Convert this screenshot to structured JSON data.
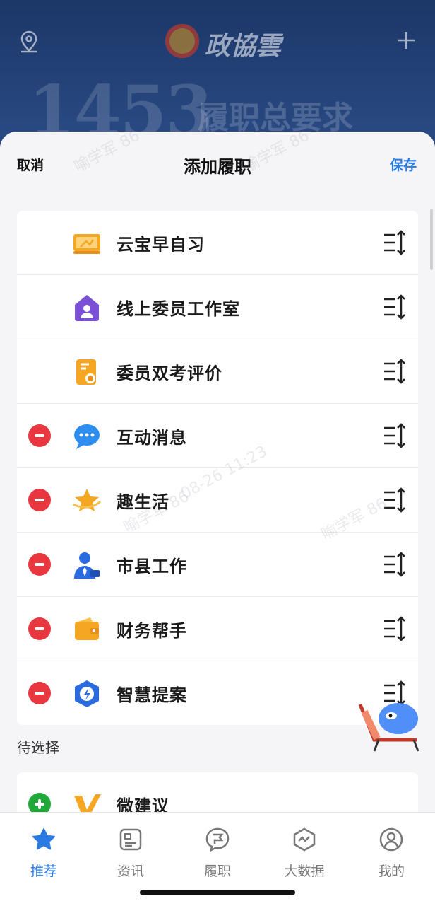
{
  "background": {
    "logo_text": "政協雲",
    "banner_number": "1453",
    "banner_text": "履职总要求"
  },
  "header": {
    "cancel_label": "取消",
    "title": "添加履职",
    "save_label": "保存"
  },
  "selected_items": [
    {
      "label": "云宝早自习",
      "icon": "blackboard-icon",
      "removable": false
    },
    {
      "label": "线上委员工作室",
      "icon": "house-person-icon",
      "removable": false
    },
    {
      "label": "委员双考评价",
      "icon": "certificate-icon",
      "removable": false
    },
    {
      "label": "互动消息",
      "icon": "chat-bubble-icon",
      "removable": true
    },
    {
      "label": "趣生活",
      "icon": "star-orbit-icon",
      "removable": true
    },
    {
      "label": "市县工作",
      "icon": "person-tie-icon",
      "removable": true
    },
    {
      "label": "财务帮手",
      "icon": "wallet-icon",
      "removable": true
    },
    {
      "label": "智慧提案",
      "icon": "lightning-shield-icon",
      "removable": true
    }
  ],
  "pending_section": {
    "label": "待选择",
    "items": [
      {
        "label": "微建议",
        "icon": "v-logo-icon"
      }
    ]
  },
  "watermark": {
    "line1": "喻学军 86",
    "line2": "08-26 11:23"
  },
  "tabbar": {
    "tabs": [
      {
        "label": "推荐",
        "icon": "star-icon",
        "active": true
      },
      {
        "label": "资讯",
        "icon": "news-icon",
        "active": false
      },
      {
        "label": "履职",
        "icon": "flag-bubble-icon",
        "active": false
      },
      {
        "label": "大数据",
        "icon": "data-hex-icon",
        "active": false
      },
      {
        "label": "我的",
        "icon": "profile-icon",
        "active": false
      }
    ]
  },
  "colors": {
    "accent": "#2a7ae4",
    "remove": "#e8373f",
    "add": "#21a83b",
    "banner": "#1c3768"
  }
}
